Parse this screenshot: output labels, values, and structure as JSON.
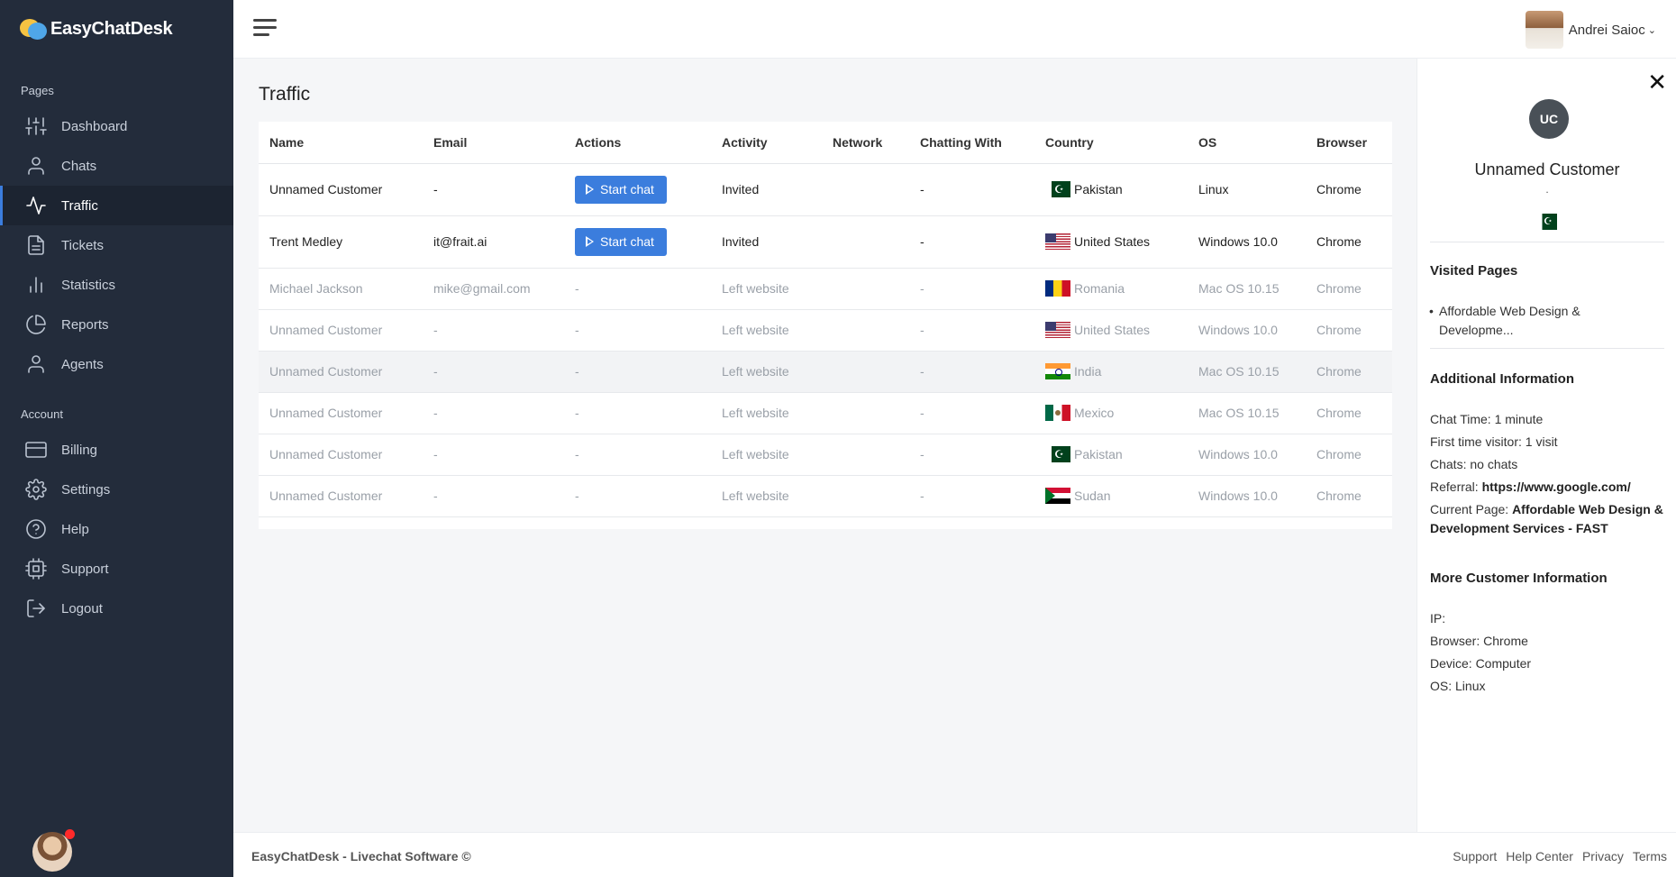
{
  "brand": {
    "name": "EasyChatDesk"
  },
  "sidebar": {
    "pages_title": "Pages",
    "account_title": "Account",
    "pages": [
      {
        "label": "Dashboard",
        "icon": "sliders-icon"
      },
      {
        "label": "Chats",
        "icon": "user-icon"
      },
      {
        "label": "Traffic",
        "icon": "activity-icon",
        "active": true
      },
      {
        "label": "Tickets",
        "icon": "file-icon"
      },
      {
        "label": "Statistics",
        "icon": "bar-chart-icon"
      },
      {
        "label": "Reports",
        "icon": "pie-chart-icon"
      },
      {
        "label": "Agents",
        "icon": "user-icon"
      }
    ],
    "account": [
      {
        "label": "Billing",
        "icon": "credit-card-icon"
      },
      {
        "label": "Settings",
        "icon": "gear-icon"
      },
      {
        "label": "Help",
        "icon": "help-circle-icon"
      },
      {
        "label": "Support",
        "icon": "cpu-icon"
      },
      {
        "label": "Logout",
        "icon": "logout-icon"
      }
    ]
  },
  "topbar": {
    "user_name": "Andrei Saioc"
  },
  "main": {
    "title": "Traffic",
    "columns": [
      "Name",
      "Email",
      "Actions",
      "Activity",
      "Network",
      "Chatting With",
      "Country",
      "OS",
      "Browser"
    ],
    "start_chat_label": "Start chat",
    "rows": [
      {
        "name": "Unnamed Customer",
        "email": "-",
        "action": "Start chat",
        "activity": "Invited",
        "network": "",
        "chatting_with": "-",
        "country": "Pakistan",
        "flag": "pk",
        "os": "Linux",
        "browser": "Chrome",
        "active": true
      },
      {
        "name": "Trent Medley",
        "email": "it@frait.ai",
        "action": "Start chat",
        "activity": "Invited",
        "network": "",
        "chatting_with": "-",
        "country": "United States",
        "flag": "us",
        "os": "Windows 10.0",
        "browser": "Chrome",
        "active": true
      },
      {
        "name": "Michael Jackson",
        "email": "mike@gmail.com",
        "action": "-",
        "activity": "Left website",
        "network": "",
        "chatting_with": "-",
        "country": "Romania",
        "flag": "ro",
        "os": "Mac OS 10.15",
        "browser": "Chrome"
      },
      {
        "name": "Unnamed Customer",
        "email": "-",
        "action": "-",
        "activity": "Left website",
        "network": "",
        "chatting_with": "-",
        "country": "United States",
        "flag": "us",
        "os": "Windows 10.0",
        "browser": "Chrome"
      },
      {
        "name": "Unnamed Customer",
        "email": "-",
        "action": "-",
        "activity": "Left website",
        "network": "",
        "chatting_with": "-",
        "country": "India",
        "flag": "in",
        "os": "Mac OS 10.15",
        "browser": "Chrome",
        "hover": true
      },
      {
        "name": "Unnamed Customer",
        "email": "-",
        "action": "-",
        "activity": "Left website",
        "network": "",
        "chatting_with": "-",
        "country": "Mexico",
        "flag": "mx",
        "os": "Mac OS 10.15",
        "browser": "Chrome"
      },
      {
        "name": "Unnamed Customer",
        "email": "-",
        "action": "-",
        "activity": "Left website",
        "network": "",
        "chatting_with": "-",
        "country": "Pakistan",
        "flag": "pk",
        "os": "Windows 10.0",
        "browser": "Chrome"
      },
      {
        "name": "Unnamed Customer",
        "email": "-",
        "action": "-",
        "activity": "Left website",
        "network": "",
        "chatting_with": "-",
        "country": "Sudan",
        "flag": "sd",
        "os": "Windows 10.0",
        "browser": "Chrome"
      }
    ]
  },
  "panel": {
    "initials": "UC",
    "name": "Unnamed Customer",
    "subtitle": ".",
    "flag": "pk",
    "visited_title": "Visited Pages",
    "visited_pages": [
      "Affordable Web Design & Developme..."
    ],
    "additional_title": "Additional Information",
    "chat_time": "Chat Time: 1 minute",
    "first_time": "First time visitor: 1 visit",
    "chats": "Chats: no chats",
    "referral_label": "Referral: ",
    "referral_value": "https://www.google.com/",
    "current_page_label": "Current Page: ",
    "current_page_value": "Affordable Web Design & Development Services - FAST",
    "more_title": "More Customer Information",
    "ip": "IP:",
    "browser": "Browser: Chrome",
    "device": "Device: Computer",
    "os": "OS: Linux"
  },
  "footer": {
    "left": "EasyChatDesk - Livechat Software ©",
    "links": [
      "Support",
      "Help Center",
      "Privacy",
      "Terms"
    ]
  },
  "colors": {
    "sidebar_bg": "#232c3b",
    "accent": "#3b7ddd",
    "avatar_bg": "#495057"
  }
}
